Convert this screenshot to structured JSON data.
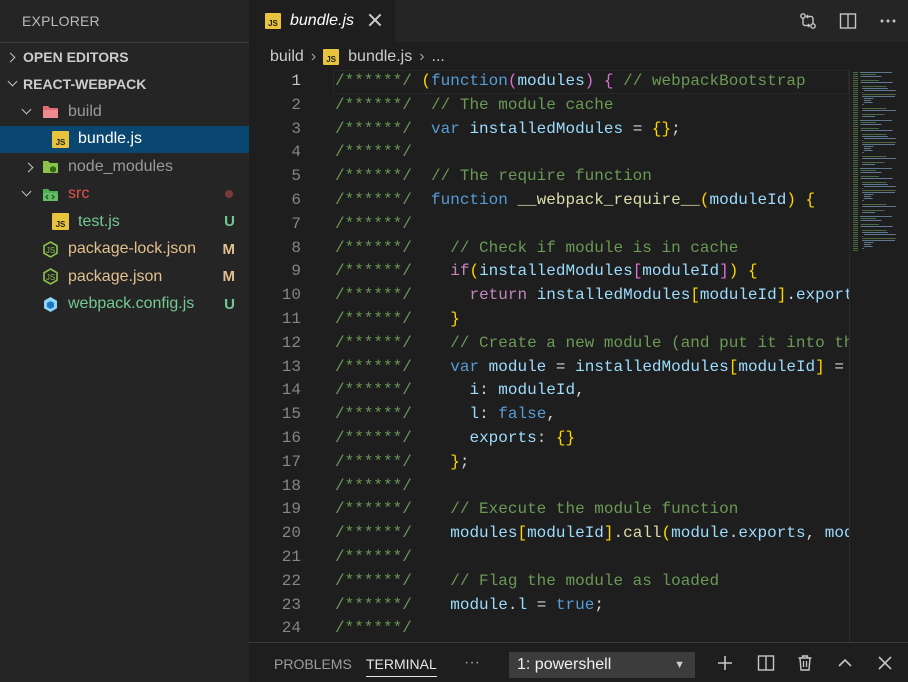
{
  "sidebar": {
    "title": "EXPLORER",
    "open_editors": "OPEN EDITORS",
    "project": "REACT-WEBPACK",
    "tree": [
      {
        "label": "build",
        "kind": "folder",
        "badge": ""
      },
      {
        "label": "bundle.js",
        "kind": "js",
        "badge": ""
      },
      {
        "label": "node_modules",
        "kind": "folder",
        "badge": ""
      },
      {
        "label": "src",
        "kind": "folder",
        "badge": ""
      },
      {
        "label": "test.js",
        "kind": "js",
        "badge": "U"
      },
      {
        "label": "package-lock.json",
        "kind": "json",
        "badge": "M"
      },
      {
        "label": "package.json",
        "kind": "json",
        "badge": "M"
      },
      {
        "label": "webpack.config.js",
        "kind": "webpack",
        "badge": "U"
      }
    ]
  },
  "tab": {
    "icon_text": "JS",
    "label": "bundle.js"
  },
  "breadcrumbs": {
    "folder": "build",
    "file": "bundle.js",
    "more": "..."
  },
  "editor": {
    "lines": [
      {
        "n": "1",
        "text": "/******/ (function(modules) { // webpackBootstrap"
      },
      {
        "n": "2",
        "text": "/******/  // The module cache"
      },
      {
        "n": "3",
        "text": "/******/  var installedModules = {};"
      },
      {
        "n": "4",
        "text": "/******/"
      },
      {
        "n": "5",
        "text": "/******/  // The require function"
      },
      {
        "n": "6",
        "text": "/******/  function __webpack_require__(moduleId) {"
      },
      {
        "n": "7",
        "text": "/******/"
      },
      {
        "n": "8",
        "text": "/******/    // Check if module is in cache"
      },
      {
        "n": "9",
        "text": "/******/    if(installedModules[moduleId]) {"
      },
      {
        "n": "10",
        "text": "/******/      return installedModules[moduleId].export"
      },
      {
        "n": "11",
        "text": "/******/    }"
      },
      {
        "n": "12",
        "text": "/******/    // Create a new module (and put it into th"
      },
      {
        "n": "13",
        "text": "/******/    var module = installedModules[moduleId] ="
      },
      {
        "n": "14",
        "text": "/******/      i: moduleId,"
      },
      {
        "n": "15",
        "text": "/******/      l: false,"
      },
      {
        "n": "16",
        "text": "/******/      exports: {}"
      },
      {
        "n": "17",
        "text": "/******/    };"
      },
      {
        "n": "18",
        "text": "/******/"
      },
      {
        "n": "19",
        "text": "/******/    // Execute the module function"
      },
      {
        "n": "20",
        "text": "/******/    modules[moduleId].call(module.exports, mod"
      },
      {
        "n": "21",
        "text": "/******/"
      },
      {
        "n": "22",
        "text": "/******/    // Flag the module as loaded"
      },
      {
        "n": "23",
        "text": "/******/    module.l = true;"
      },
      {
        "n": "24",
        "text": "/******/"
      }
    ]
  },
  "panel": {
    "problems": "PROBLEMS",
    "terminal": "TERMINAL",
    "more": "···",
    "terminal_select": "1: powershell"
  },
  "colors": {
    "sidebar_bg": "#252526",
    "editor_bg": "#1e1e1e",
    "selection": "#094771",
    "untracked": "#73c991",
    "modified": "#e2c08d"
  }
}
